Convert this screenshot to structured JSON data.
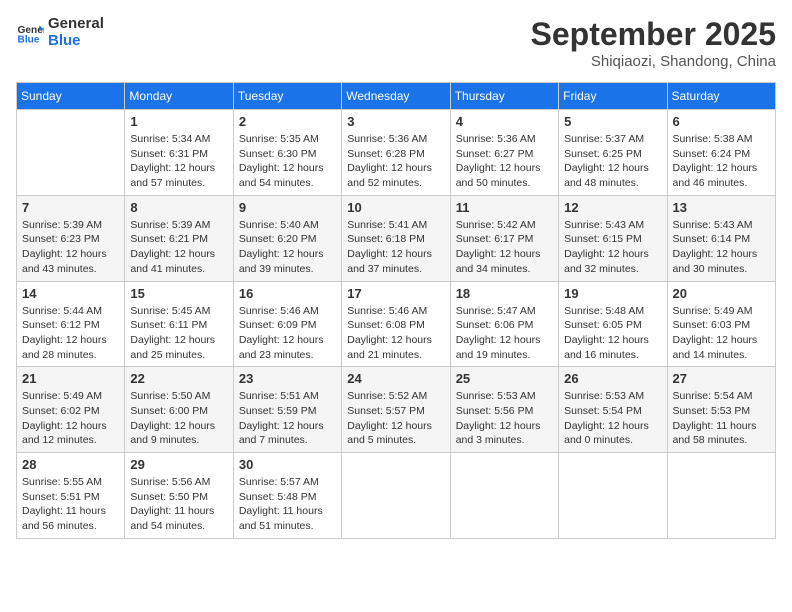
{
  "header": {
    "logo_line1": "General",
    "logo_line2": "Blue",
    "month": "September 2025",
    "location": "Shiqiaozi, Shandong, China"
  },
  "days_of_week": [
    "Sunday",
    "Monday",
    "Tuesday",
    "Wednesday",
    "Thursday",
    "Friday",
    "Saturday"
  ],
  "weeks": [
    [
      {
        "day": "",
        "info": ""
      },
      {
        "day": "1",
        "info": "Sunrise: 5:34 AM\nSunset: 6:31 PM\nDaylight: 12 hours\nand 57 minutes."
      },
      {
        "day": "2",
        "info": "Sunrise: 5:35 AM\nSunset: 6:30 PM\nDaylight: 12 hours\nand 54 minutes."
      },
      {
        "day": "3",
        "info": "Sunrise: 5:36 AM\nSunset: 6:28 PM\nDaylight: 12 hours\nand 52 minutes."
      },
      {
        "day": "4",
        "info": "Sunrise: 5:36 AM\nSunset: 6:27 PM\nDaylight: 12 hours\nand 50 minutes."
      },
      {
        "day": "5",
        "info": "Sunrise: 5:37 AM\nSunset: 6:25 PM\nDaylight: 12 hours\nand 48 minutes."
      },
      {
        "day": "6",
        "info": "Sunrise: 5:38 AM\nSunset: 6:24 PM\nDaylight: 12 hours\nand 46 minutes."
      }
    ],
    [
      {
        "day": "7",
        "info": "Sunrise: 5:39 AM\nSunset: 6:23 PM\nDaylight: 12 hours\nand 43 minutes."
      },
      {
        "day": "8",
        "info": "Sunrise: 5:39 AM\nSunset: 6:21 PM\nDaylight: 12 hours\nand 41 minutes."
      },
      {
        "day": "9",
        "info": "Sunrise: 5:40 AM\nSunset: 6:20 PM\nDaylight: 12 hours\nand 39 minutes."
      },
      {
        "day": "10",
        "info": "Sunrise: 5:41 AM\nSunset: 6:18 PM\nDaylight: 12 hours\nand 37 minutes."
      },
      {
        "day": "11",
        "info": "Sunrise: 5:42 AM\nSunset: 6:17 PM\nDaylight: 12 hours\nand 34 minutes."
      },
      {
        "day": "12",
        "info": "Sunrise: 5:43 AM\nSunset: 6:15 PM\nDaylight: 12 hours\nand 32 minutes."
      },
      {
        "day": "13",
        "info": "Sunrise: 5:43 AM\nSunset: 6:14 PM\nDaylight: 12 hours\nand 30 minutes."
      }
    ],
    [
      {
        "day": "14",
        "info": "Sunrise: 5:44 AM\nSunset: 6:12 PM\nDaylight: 12 hours\nand 28 minutes."
      },
      {
        "day": "15",
        "info": "Sunrise: 5:45 AM\nSunset: 6:11 PM\nDaylight: 12 hours\nand 25 minutes."
      },
      {
        "day": "16",
        "info": "Sunrise: 5:46 AM\nSunset: 6:09 PM\nDaylight: 12 hours\nand 23 minutes."
      },
      {
        "day": "17",
        "info": "Sunrise: 5:46 AM\nSunset: 6:08 PM\nDaylight: 12 hours\nand 21 minutes."
      },
      {
        "day": "18",
        "info": "Sunrise: 5:47 AM\nSunset: 6:06 PM\nDaylight: 12 hours\nand 19 minutes."
      },
      {
        "day": "19",
        "info": "Sunrise: 5:48 AM\nSunset: 6:05 PM\nDaylight: 12 hours\nand 16 minutes."
      },
      {
        "day": "20",
        "info": "Sunrise: 5:49 AM\nSunset: 6:03 PM\nDaylight: 12 hours\nand 14 minutes."
      }
    ],
    [
      {
        "day": "21",
        "info": "Sunrise: 5:49 AM\nSunset: 6:02 PM\nDaylight: 12 hours\nand 12 minutes."
      },
      {
        "day": "22",
        "info": "Sunrise: 5:50 AM\nSunset: 6:00 PM\nDaylight: 12 hours\nand 9 minutes."
      },
      {
        "day": "23",
        "info": "Sunrise: 5:51 AM\nSunset: 5:59 PM\nDaylight: 12 hours\nand 7 minutes."
      },
      {
        "day": "24",
        "info": "Sunrise: 5:52 AM\nSunset: 5:57 PM\nDaylight: 12 hours\nand 5 minutes."
      },
      {
        "day": "25",
        "info": "Sunrise: 5:53 AM\nSunset: 5:56 PM\nDaylight: 12 hours\nand 3 minutes."
      },
      {
        "day": "26",
        "info": "Sunrise: 5:53 AM\nSunset: 5:54 PM\nDaylight: 12 hours\nand 0 minutes."
      },
      {
        "day": "27",
        "info": "Sunrise: 5:54 AM\nSunset: 5:53 PM\nDaylight: 11 hours\nand 58 minutes."
      }
    ],
    [
      {
        "day": "28",
        "info": "Sunrise: 5:55 AM\nSunset: 5:51 PM\nDaylight: 11 hours\nand 56 minutes."
      },
      {
        "day": "29",
        "info": "Sunrise: 5:56 AM\nSunset: 5:50 PM\nDaylight: 11 hours\nand 54 minutes."
      },
      {
        "day": "30",
        "info": "Sunrise: 5:57 AM\nSunset: 5:48 PM\nDaylight: 11 hours\nand 51 minutes."
      },
      {
        "day": "",
        "info": ""
      },
      {
        "day": "",
        "info": ""
      },
      {
        "day": "",
        "info": ""
      },
      {
        "day": "",
        "info": ""
      }
    ]
  ]
}
